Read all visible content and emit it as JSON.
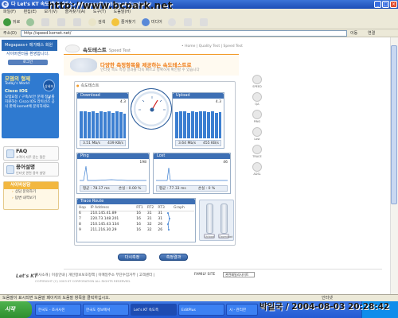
{
  "window": {
    "title": "다 Let's KT 속도 측정서비스 - Microsoft Internet Explorer",
    "watermark": "http://www.bcpark.net"
  },
  "menu": [
    "파일(F)",
    "편집(E)",
    "보기(V)",
    "즐겨찾기(A)",
    "도구(T)",
    "도움말(H)"
  ],
  "toolbar": {
    "back": "뒤로",
    "search": "검색",
    "favorites": "즐겨찾기",
    "media": "미디어"
  },
  "address": {
    "label": "주소(D)",
    "url": "http://speed.kornet.net/",
    "go": "이동",
    "links": "연결"
  },
  "leftnav": {
    "header": "Megapass+ 메가패스 회원",
    "welcome": "사이버센터를 환영합니다.",
    "login": "로그인",
    "promo": {
      "t1": "모뎀의 형제",
      "t1b": "Today's World",
      "t3": "Cisco IOS",
      "t2": "모뎀요청 / 구축/보안 문제 정보를 지원하는 Cisco IOS 라이선스 공식 판매 kornet에 문의하세요.",
      "circle": "상세보기"
    },
    "faq": {
      "title": "FAQ",
      "sub": "고객이 자주 묻는 질문"
    },
    "guide": {
      "title": "용어설명",
      "sub": "인터넷 관련 용어 설명"
    },
    "consult": {
      "title": "사이버상담",
      "items": [
        "상담 문의하기",
        "답변 내역보기"
      ]
    }
  },
  "header": {
    "title": "속도테스트",
    "subtitle": "Speed Test",
    "crumbs": "• Home | Quality Test | Speed Test"
  },
  "banner": {
    "title": "다양한 측정항목을 제공하는 속도테스트로",
    "subtitle": "인터넷 속도 측정 결과를 더욱 빠르고 정확하게 확인할 수 있습니다"
  },
  "panel": {
    "title": "속도테스트"
  },
  "download": {
    "label": "Download",
    "scale": "4.3",
    "speed": "3.51 Mb/s",
    "bytes": "439 KB/s"
  },
  "upload": {
    "label": "Upload",
    "scale": "4.3",
    "speed": "3.64 Mb/s",
    "bytes": "455 KB/s"
  },
  "ping": {
    "label": "Ping",
    "scale": "198",
    "avg": "평균 : 78.17 ms",
    "loss": "손실 : 0.00 %"
  },
  "lost": {
    "label": "Lost",
    "scale": "46",
    "avg": "평균 : 77.33 ms",
    "loss": "손실 : 0 %"
  },
  "trace": {
    "label": "Trace Route",
    "columns": [
      "Hop",
      "IP Address",
      "RT1",
      "RT2",
      "RT3",
      "Graph"
    ],
    "rows": [
      [
        "6",
        "210.145.41.89",
        "16",
        "31",
        "31"
      ],
      [
        "7",
        "220.73.148.201",
        "16",
        "31",
        "31"
      ],
      [
        "8",
        "210.145.43.134",
        "16",
        "32",
        "26"
      ],
      [
        "9",
        "211.216.30.29",
        "16",
        "32",
        "26"
      ]
    ],
    "bar_labels": [
      "Upload",
      "Download"
    ]
  },
  "buttons": {
    "retest": "다시측정",
    "result": "측정결과"
  },
  "right_icons": [
    "SPEED",
    "QA",
    "PING",
    "Lost",
    "TRACE",
    "ADSL"
  ],
  "footer": {
    "logo": "Let's KT",
    "links": "회사소개 | 이용안내 | 개인정보보호정책 | 이메일주소 무단수집거부 | 고객센터 |",
    "copyright": "COPYRIGHT (C) 2003 KT CORPORATION ALL RIGHTS RESERVED.",
    "family": "FAMILY SITE",
    "family_select": "관련패밀리사이트"
  },
  "status": {
    "left": "도움말이 표시되면 도움말 페이지의 도움말 항목을 클릭하십시오.",
    "zone": "인터넷"
  },
  "taskbar": {
    "start": "시작",
    "tasks": [
      "한국도 - 조사사진",
      "한국도 정보에서",
      "Let's KT 속도측",
      "EditPlus",
      "시 - 관리한"
    ],
    "stamp": "박일국 / 2004-08-03 20:28:42"
  }
}
